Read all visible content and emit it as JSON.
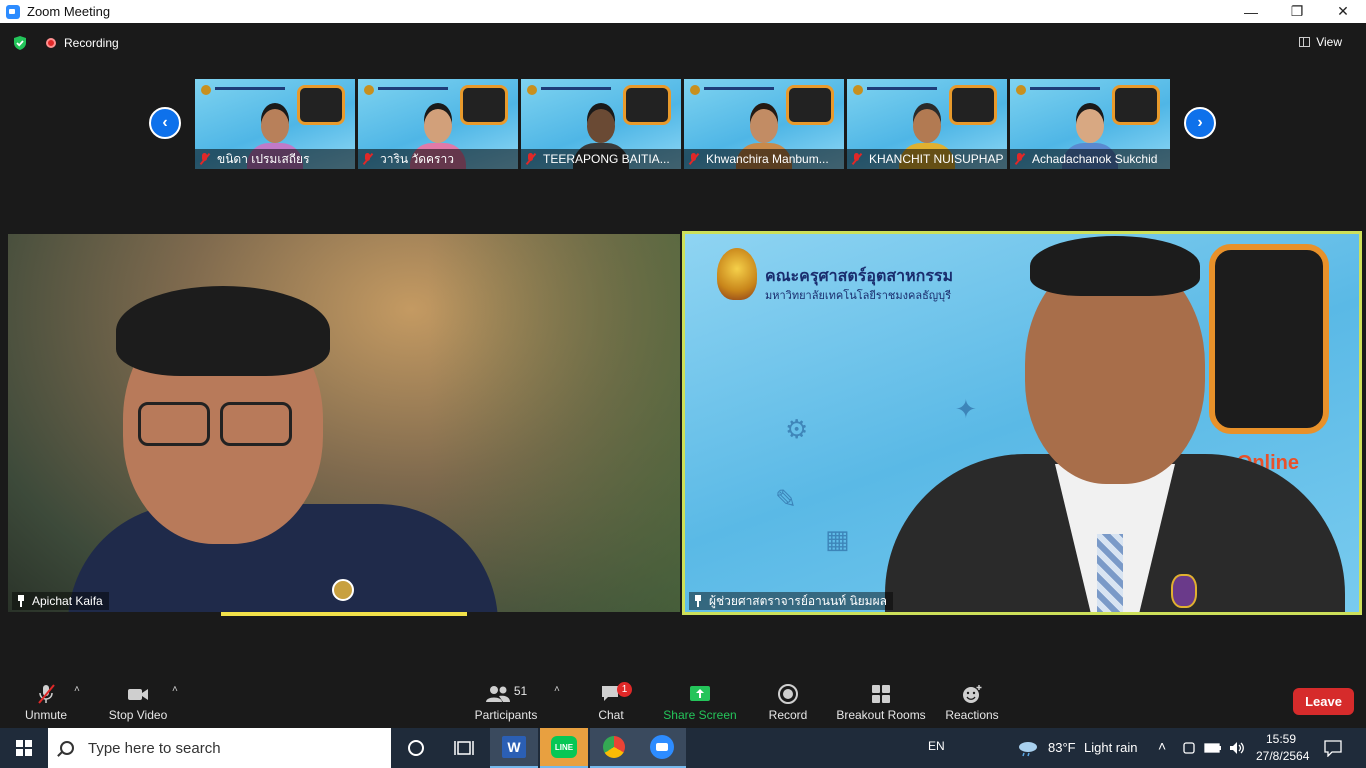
{
  "window": {
    "title": "Zoom Meeting",
    "minimize": "—",
    "restore": "❐",
    "close": "✕"
  },
  "top": {
    "recording_label": "Recording",
    "view_label": "View"
  },
  "strip": {
    "prev_arrow": "‹",
    "next_arrow": "›",
    "participants": [
      {
        "name": "ขนิดา เปรมเสถียร",
        "skin": "#b8805a",
        "shirt": "#c07ac8",
        "hair": "#1a1a1a"
      },
      {
        "name": "วาริน วัดคราว",
        "skin": "#d2a07a",
        "shirt": "#e07aa8",
        "hair": "#1a1a1a"
      },
      {
        "name": "TEERAPONG BAITIA...",
        "skin": "#6a4a34",
        "shirt": "#3a3a3a",
        "hair": "#1a1a1a"
      },
      {
        "name": "Khwanchira Manbum...",
        "skin": "#c28c64",
        "shirt": "#c88a4a",
        "hair": "#241a14"
      },
      {
        "name": "KHANCHIT NUISUPHAP",
        "skin": "#b27a52",
        "shirt": "#e0b030",
        "hair": "#2a2a2a"
      },
      {
        "name": "Achadachanok Sukchid",
        "skin": "#d8a882",
        "shirt": "#5a8ad0",
        "hair": "#1a1a1a"
      }
    ]
  },
  "videos": {
    "left": {
      "name": "Apichat Kaifa"
    },
    "right": {
      "name": "ผู้ช่วยศาสตราจารย์อานนท์ นิยมผล",
      "slide_title": "คณะครุศาสตร์อุตสาหกรรม",
      "slide_subtitle": "มหาวิทยาลัยเทคโนโลยีราชมงคลธัญบุรี",
      "slide_online": "Online"
    }
  },
  "toolbar": {
    "unmute": "Unmute",
    "stop_video": "Stop Video",
    "participants": "Participants",
    "participants_count": "51",
    "chat": "Chat",
    "chat_badge": "1",
    "share_screen": "Share Screen",
    "record": "Record",
    "breakout_rooms": "Breakout Rooms",
    "reactions": "Reactions",
    "leave": "Leave",
    "caret": "˄"
  },
  "taskbar": {
    "search_placeholder": "Type here to search",
    "lang": "EN",
    "weather_temp": "83°F",
    "weather_desc": "Light rain",
    "time": "15:59",
    "date": "27/8/2564"
  },
  "colors": {
    "accent": "#0e71eb",
    "active_speaker": "#cde05a",
    "leave": "#d62b2b",
    "share": "#24c45a"
  }
}
